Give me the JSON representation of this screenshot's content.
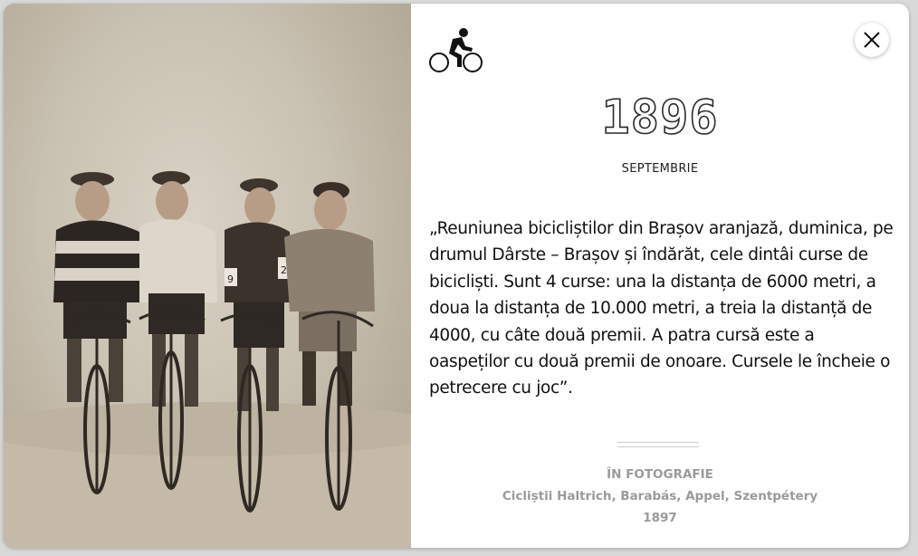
{
  "colors": {
    "card_background": "#ffffff",
    "text": "#111111",
    "caption": "#9a9a9a",
    "photo_sepia": "#c9c1b1"
  },
  "photo": {
    "description_icon": "sepia-photo-four-cyclists"
  },
  "header": {
    "category_icon": "bicycle-rider-icon",
    "close_icon": "close-icon"
  },
  "event": {
    "year": "1896",
    "month": "SEPTEMBRIE",
    "quote": "„Reuniunea bicicliștilor din Brașov aranjază, duminica, pe drumul Dârste – Brașov și îndărăt, cele dintâi curse de bicicliști. Sunt 4 curse: una la distanța de 6000 metri, a doua la distanța de 10.000 metri, a treia la distanță de 4000, cu câte două premii. A patra cursă este a oaspeților cu două premii de onoare. Cursele le încheie o petrecere cu joc”."
  },
  "caption": {
    "heading": "ÎN FOTOGRAFIE",
    "subjects": "Cicliștii Haltrich, Barabás, Appel, Szentpétery",
    "year": "1897"
  }
}
